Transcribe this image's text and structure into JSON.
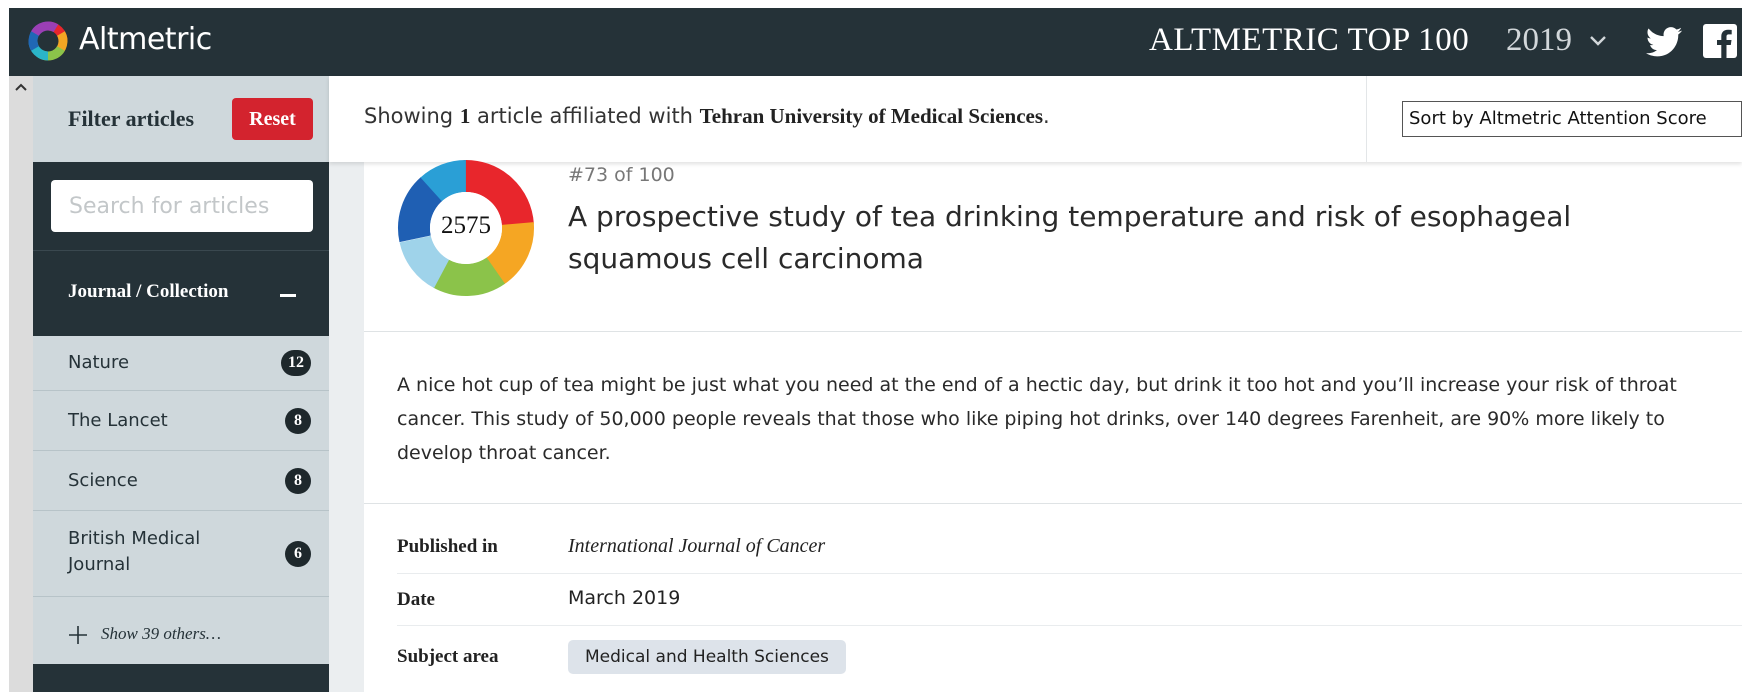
{
  "header": {
    "brand": "Altmetric",
    "title": "ALTMETRIC TOP 100",
    "year": "2019",
    "icons": [
      "altmetric-logo-icon",
      "chevron-down-icon",
      "twitter-icon",
      "facebook-icon"
    ]
  },
  "sidebar": {
    "filter_title": "Filter articles",
    "reset_label": "Reset",
    "search_placeholder": "Search for articles",
    "section_title": "Journal / Collection",
    "items": [
      {
        "label": "Nature",
        "count": "12"
      },
      {
        "label": "The Lancet",
        "count": "8"
      },
      {
        "label": "Science",
        "count": "8"
      },
      {
        "label": "British Medical Journal",
        "count": "6"
      }
    ],
    "show_more": "Show 39 others…"
  },
  "results": {
    "prefix": "Showing",
    "count": "1",
    "middle": "article affiliated with",
    "institution": "Tehran University of Medical Sciences",
    "suffix": ".",
    "sort_label": "Sort by Altmetric Attention Score"
  },
  "article": {
    "score": "2575",
    "rank": "#73 of 100",
    "title": "A prospective study of tea drinking temperature and risk of esophageal squamous cell carcinoma",
    "summary": "A nice hot cup of tea might be just what you need at the end of a hectic day, but drink it too hot and you’ll increase your risk of throat cancer. This study of 50,000 people reveals that those who like piping hot drinks, over 140 degrees Farenheit, are 90% more likely to develop throat cancer.",
    "published_label": "Published in",
    "published_value": "International Journal of Cancer",
    "date_label": "Date",
    "date_value": "March 2019",
    "subject_label": "Subject area",
    "subject_value": "Medical and Health Sciences"
  },
  "colors": {
    "header_bg": "#253238",
    "sidebar_bg": "#cfd8dc",
    "reset_red": "#d3232e",
    "badge": "#1e282c",
    "tag_bg": "#dde3ea"
  }
}
